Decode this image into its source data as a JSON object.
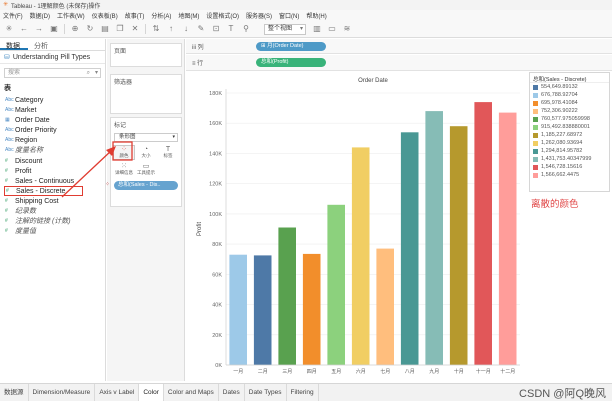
{
  "window": {
    "title": "Tableau - 1理解颜色 (未保存)操作"
  },
  "menu": [
    "文件(F)",
    "数据(D)",
    "工作表(W)",
    "仪表板(B)",
    "故事(T)",
    "分析(A)",
    "地图(M)",
    "设置格式(O)",
    "服务器(S)",
    "窗口(N)",
    "帮助(H)"
  ],
  "toolbar": {
    "view_select": "整个视图"
  },
  "left_panel": {
    "tab_data": "数据",
    "tab_analysis": "分析",
    "datasource": "Understanding Pill Types",
    "search_placeholder": "搜索",
    "section_tables": "表",
    "fields": [
      {
        "name": "Category",
        "kind": "dim",
        "icon": "Abc"
      },
      {
        "name": "Market",
        "kind": "dim",
        "icon": "Abc"
      },
      {
        "name": "Order Date",
        "kind": "dim",
        "icon": "▦"
      },
      {
        "name": "Order Priority",
        "kind": "dim",
        "icon": "Abc"
      },
      {
        "name": "Region",
        "kind": "dim",
        "icon": "Abc"
      },
      {
        "name": "度量名称",
        "kind": "dim",
        "icon": "Abc",
        "italic": true
      },
      {
        "name": "Discount",
        "kind": "mea",
        "icon": "#"
      },
      {
        "name": "Profit",
        "kind": "mea",
        "icon": "#"
      },
      {
        "name": "Sales - Continuous",
        "kind": "mea",
        "icon": "#"
      },
      {
        "name": "Sales - Discrete",
        "kind": "mea",
        "icon": "#",
        "highlight": true
      },
      {
        "name": "Shipping Cost",
        "kind": "mea",
        "icon": "#"
      },
      {
        "name": "纪录数",
        "kind": "mea",
        "icon": "#",
        "italic": true
      },
      {
        "name": "注解的链接 (计数)",
        "kind": "mea",
        "icon": "#",
        "italic": true
      },
      {
        "name": "度量值",
        "kind": "mea",
        "icon": "#",
        "italic": true
      }
    ]
  },
  "shelves": {
    "pages": "页面",
    "filters": "筛选器",
    "marks": "标记",
    "mark_type": "条形图",
    "buttons": [
      {
        "label": "颜色",
        "glyph": "⁘",
        "cls": "color"
      },
      {
        "label": "大小",
        "glyph": "◔",
        "cls": ""
      },
      {
        "label": "标签",
        "glyph": "T",
        "cls": ""
      },
      {
        "label": "详细信息",
        "glyph": "⁙",
        "cls": ""
      },
      {
        "label": "工具提示",
        "glyph": "▭",
        "cls": ""
      }
    ],
    "color_pill": "总和(Sales - Dis..",
    "columns_label": "iii 列",
    "rows_label": "≡ 行",
    "columns_pill": "⊞ 月(Order Date)",
    "rows_pill": "总和(Profit)"
  },
  "chart_data": {
    "type": "bar",
    "title": "Order Date",
    "ylabel": "Profit",
    "categories": [
      "一月",
      "二月",
      "三月",
      "四月",
      "五月",
      "六月",
      "七月",
      "八月",
      "九月",
      "十月",
      "十一月",
      "十二月"
    ],
    "values": [
      73000,
      72500,
      91000,
      73500,
      106000,
      144000,
      77000,
      154000,
      168000,
      158000,
      174000,
      167000
    ],
    "colors": [
      "#9dc9e8",
      "#4e79a7",
      "#59a14f",
      "#f28e2b",
      "#8cd17d",
      "#f1ce63",
      "#ffbe7d",
      "#499894",
      "#86bcb6",
      "#b6992d",
      "#e15759",
      "#ff9d9a"
    ],
    "ylim": [
      0,
      180000
    ],
    "yticks": [
      0,
      20000,
      40000,
      60000,
      80000,
      100000,
      120000,
      140000,
      160000,
      180000
    ],
    "ytick_labels": [
      "0K",
      "20K",
      "40K",
      "60K",
      "80K",
      "100K",
      "120K",
      "140K",
      "160K",
      "180K"
    ]
  },
  "legend": {
    "title": "总和(Sales - Discrete)",
    "entries": [
      {
        "label": "554,649.89132",
        "color": "#4e79a7"
      },
      {
        "label": "676,788.92704",
        "color": "#9dc9e8"
      },
      {
        "label": "695,978.41084",
        "color": "#f28e2b"
      },
      {
        "label": "752,306.90222",
        "color": "#ffbe7d"
      },
      {
        "label": "760,577.975059998",
        "color": "#59a14f"
      },
      {
        "label": "915,492.838880001",
        "color": "#8cd17d"
      },
      {
        "label": "1,185,227.68972",
        "color": "#b6992d"
      },
      {
        "label": "1,262,080.93694",
        "color": "#f1ce63"
      },
      {
        "label": "1,294,814.95782",
        "color": "#499894"
      },
      {
        "label": "1,431,753.40347999",
        "color": "#86bcb6"
      },
      {
        "label": "1,546,728.15616",
        "color": "#e15759"
      },
      {
        "label": "1,566,662.4475",
        "color": "#ff9d9a"
      }
    ]
  },
  "annotation": "离散的颜色",
  "statusbar": {
    "items": [
      "数据源",
      "Dimension/Measure",
      "Axis v Label",
      "Color",
      "Color and Maps",
      "Dates",
      "Date Types",
      "Filtering"
    ],
    "active": "Color"
  },
  "watermark": "CSDN @阿Q晚风"
}
